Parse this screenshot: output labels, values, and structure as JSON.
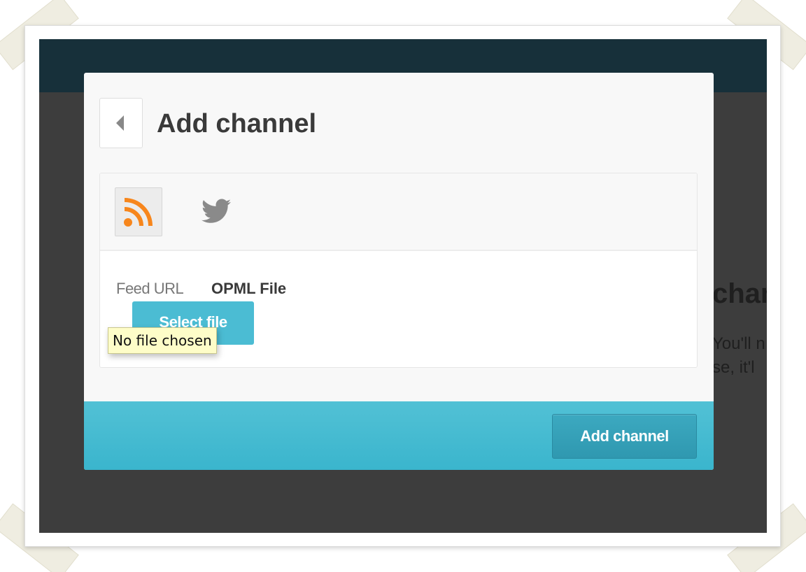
{
  "modal": {
    "title": "Add channel",
    "back_icon": "chevron-left-icon"
  },
  "channel_types": [
    {
      "name": "RSS",
      "icon": "rss-icon",
      "selected": true
    },
    {
      "name": "Twitter",
      "icon": "twitter-icon",
      "selected": false
    }
  ],
  "source_tabs": {
    "feed_url_label": "Feed URL",
    "opml_file_label": "OPML File",
    "active": "OPML File"
  },
  "file_input": {
    "button_label": "Select file",
    "tooltip": "No file chosen"
  },
  "footer": {
    "add_channel_label": "Add channel"
  },
  "background": {
    "heading_fragment": "chan",
    "line1_fragment": "You'll n",
    "line2_fragment": "se, it'l"
  },
  "colors": {
    "accent": "#4bbcd3",
    "rss_orange": "#f7861c",
    "overlay": "#3d3d3d",
    "topbar": "#17303a"
  }
}
